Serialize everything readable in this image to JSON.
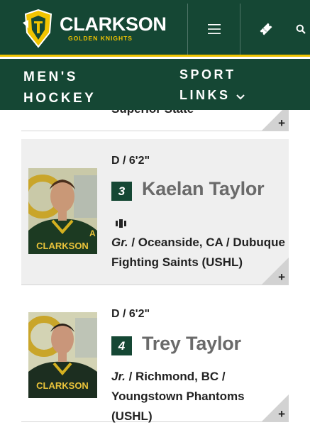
{
  "header": {
    "brand_name": "CLARKSON",
    "brand_sub": "GOLDEN KNIGHTS",
    "menu_icon": "hamburger-icon",
    "ticket_icon": "ticket-icon",
    "search_icon": "search-icon",
    "colors": {
      "green": "#154734",
      "gold": "#f1c400"
    }
  },
  "sport_nav": {
    "title_line1": "MEN'S",
    "title_line2": "HOCKEY",
    "links_line1": "SPORT",
    "links_line2": "LINKS"
  },
  "roster": {
    "prev_card_text": "Superior State",
    "players": [
      {
        "position": "D / 6'2\"",
        "number": "3",
        "name": "Kaelan Taylor",
        "class": "Gr.",
        "details": " / Oceanside, CA / Dubuque Fighting Saints (USHL)",
        "social_icon": "social-media-icon",
        "jersey_text": "CLARKSON"
      },
      {
        "position": "D / 6'2\"",
        "number": "4",
        "name": "Trey Taylor",
        "class": "Jr.",
        "details": " / Richmond, BC / Youngstown Phantoms (USHL)",
        "jersey_text": "CLARKSON"
      }
    ],
    "expand_label": "+"
  }
}
